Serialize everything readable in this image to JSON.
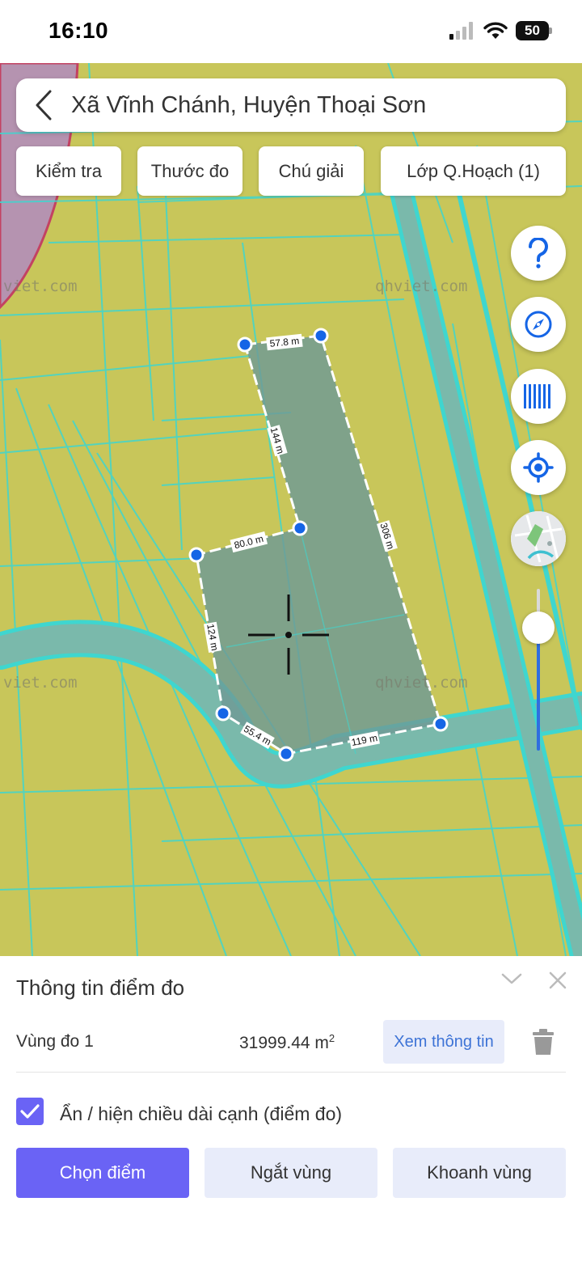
{
  "status_bar": {
    "time": "16:10",
    "battery": "50"
  },
  "search": {
    "location": "Xã Vĩnh Chánh, Huyện Thoại Sơn"
  },
  "toolbar": {
    "check": "Kiểm tra",
    "ruler": "Thước đo",
    "legend": "Chú giải",
    "layer": "Lớp Q.Hoạch (1)"
  },
  "map": {
    "watermark": "qhviet.com",
    "watermark_partial": "viet.com",
    "edges": [
      "57.8 m",
      "306 m",
      "119 m",
      "55.4 m",
      "124 m",
      "80.0 m",
      "144 m"
    ],
    "side_buttons": [
      "help-icon",
      "compass-icon",
      "barcode-icon",
      "locate-icon",
      "basemap-icon"
    ],
    "colors": {
      "land": "#c8c65a",
      "canal": "#6fb7b0",
      "boundary": "#3fd6cf",
      "area_fill": "#6f9a95",
      "vertex": "#1565e6"
    }
  },
  "panel": {
    "title": "Thông tin điểm đo",
    "area_name": "Vùng đo 1",
    "area_value": "31999.44 m",
    "area_unit_sup": "2",
    "view_info": "Xem thông tin",
    "toggle_label": "Ẩn / hiện chiều dài cạnh (điểm đo)",
    "toggle_checked": true,
    "buttons": {
      "pick": "Chọn điểm",
      "break": "Ngắt vùng",
      "close_area": "Khoanh vùng"
    }
  }
}
